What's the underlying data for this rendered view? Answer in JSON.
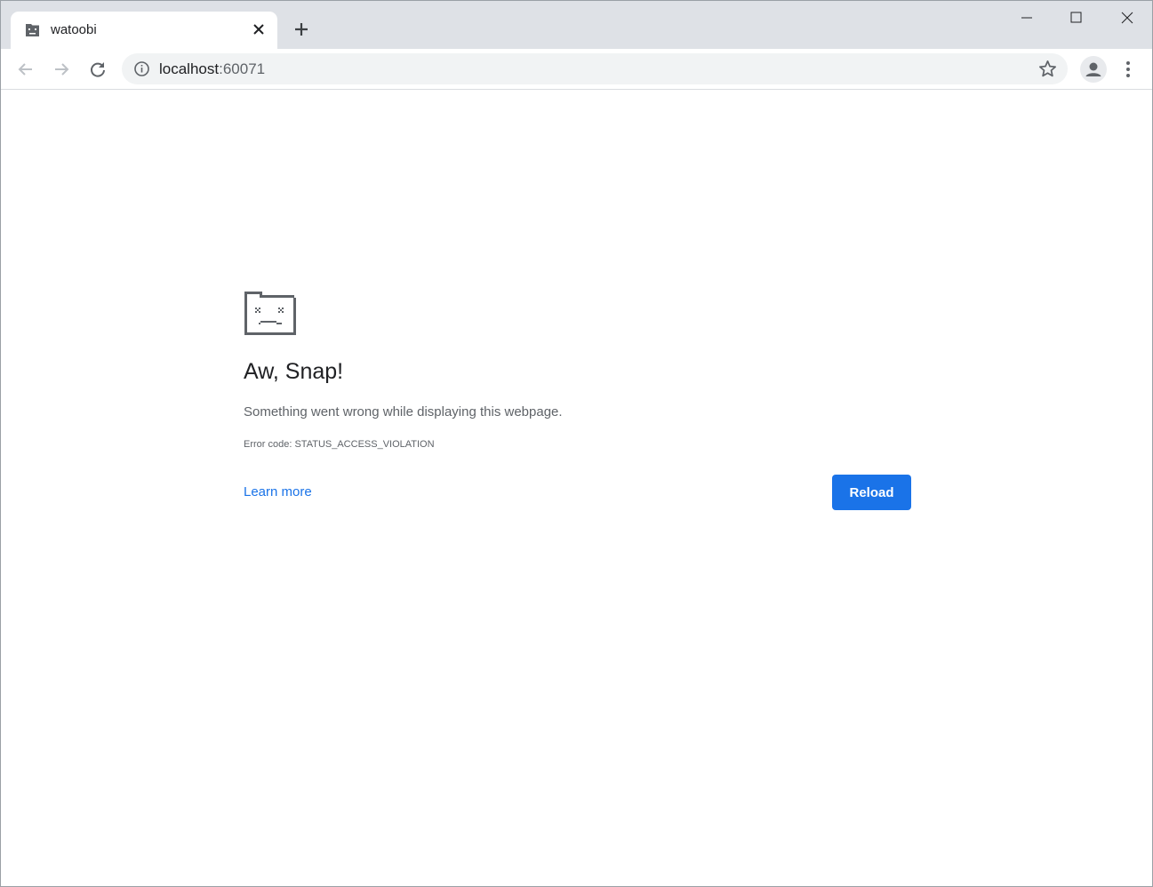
{
  "tab": {
    "title": "watoobi",
    "favicon": "sad-tab-icon"
  },
  "toolbar": {
    "url_host": "localhost",
    "url_port": ":60071"
  },
  "error": {
    "heading": "Aw, Snap!",
    "message": "Something went wrong while displaying this webpage.",
    "code": "Error code: STATUS_ACCESS_VIOLATION",
    "learn_more": "Learn more",
    "reload": "Reload"
  },
  "colors": {
    "accent": "#1a73e8",
    "tabstrip": "#dee1e6",
    "omnibox": "#f1f3f4"
  }
}
